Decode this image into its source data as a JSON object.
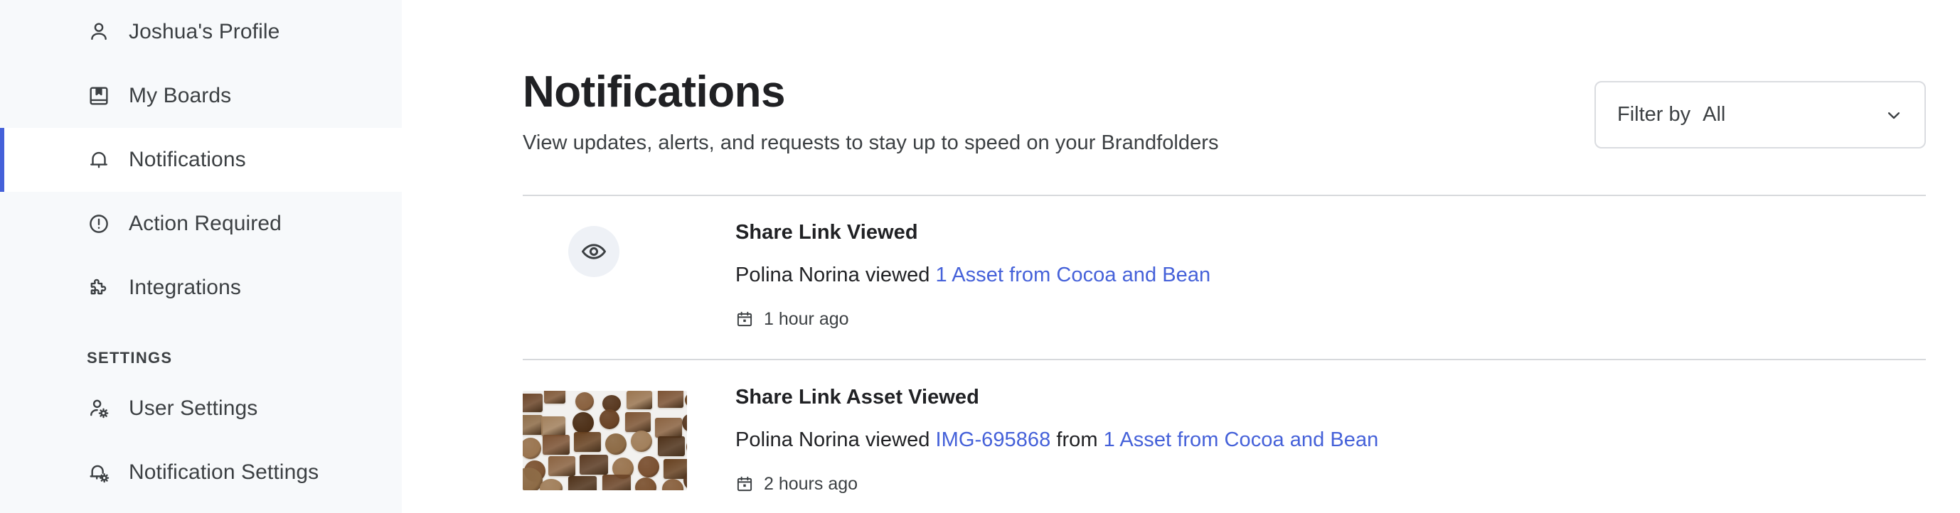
{
  "sidebar": {
    "items": [
      {
        "label": "Joshua's Profile",
        "icon": "user-icon",
        "active": false
      },
      {
        "label": "My Boards",
        "icon": "book-bookmark-icon",
        "active": false
      },
      {
        "label": "Notifications",
        "icon": "bell-icon",
        "active": true
      },
      {
        "label": "Action Required",
        "icon": "alert-circle-icon",
        "active": false
      },
      {
        "label": "Integrations",
        "icon": "puzzle-piece-icon",
        "active": false
      }
    ],
    "section_label": "SETTINGS",
    "settings_items": [
      {
        "label": "User Settings",
        "icon": "user-gear-icon",
        "active": false
      },
      {
        "label": "Notification Settings",
        "icon": "bell-gear-icon",
        "active": false
      }
    ],
    "active_accent_color": "#4561d9",
    "background_color": "#f7f9fb"
  },
  "header": {
    "title": "Notifications",
    "subtitle": "View updates, alerts, and requests to stay up to speed on your Brandfolders"
  },
  "filter": {
    "label": "Filter by",
    "value": "All",
    "caret_icon": "chevron-down-icon"
  },
  "notifications": [
    {
      "title": "Share Link Viewed",
      "media_type": "eye-icon",
      "text_before": "Polina Norina viewed ",
      "link1": "1 Asset from Cocoa and Bean",
      "text_middle": "",
      "link2": "",
      "timestamp": "1 hour ago",
      "timestamp_icon": "calendar-icon"
    },
    {
      "title": "Share Link Asset Viewed",
      "media_type": "thumbnail-chocolates",
      "text_before": "Polina Norina viewed ",
      "link1": "IMG-695868",
      "text_middle": " from ",
      "link2": "1 Asset from Cocoa and Bean",
      "timestamp": "2 hours ago",
      "timestamp_icon": "calendar-icon"
    }
  ],
  "colors": {
    "link": "#4561d9",
    "text": "#202124",
    "muted": "#3c4043",
    "divider": "#d7d9dc"
  }
}
